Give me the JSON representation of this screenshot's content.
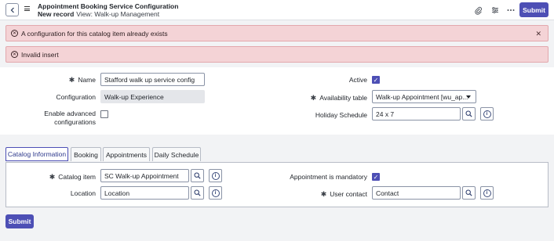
{
  "header": {
    "title": "Appointment Booking Service Configuration",
    "subtitle": "New record",
    "view_label": "View: Walk-up Management",
    "submit_label": "Submit"
  },
  "alerts": [
    {
      "text": "A configuration for this catalog item already exists",
      "closable": true
    },
    {
      "text": "Invalid insert",
      "closable": false
    }
  ],
  "form": {
    "name": {
      "label": "Name",
      "value": "Stafford walk up service config",
      "required": true
    },
    "configuration": {
      "label": "Configuration",
      "value": "Walk-up Experience"
    },
    "enable_advanced": {
      "label_line1": "Enable advanced",
      "label_line2": "configurations",
      "checked": false
    },
    "active": {
      "label": "Active",
      "checked": true
    },
    "availability_table": {
      "label": "Availability table",
      "value": "Walk-up Appointment [wu_ap...",
      "required": true
    },
    "holiday_schedule": {
      "label": "Holiday Schedule",
      "value": "24 x 7"
    }
  },
  "tabs": [
    {
      "label": "Catalog Information",
      "active": true
    },
    {
      "label": "Booking",
      "active": false
    },
    {
      "label": "Appointments",
      "active": false
    },
    {
      "label": "Daily Schedule",
      "active": false
    }
  ],
  "catalog": {
    "catalog_item": {
      "label": "Catalog item",
      "value": "SC Walk-up Appointment",
      "required": true
    },
    "location": {
      "label": "Location",
      "placeholder": "Location"
    },
    "appointment_mandatory": {
      "label": "Appointment is mandatory",
      "checked": true
    },
    "user_contact": {
      "label": "User contact",
      "placeholder": "Contact",
      "required": true
    }
  },
  "footer": {
    "submit_label": "Submit"
  },
  "icons": {
    "back": "chevron-left-icon",
    "menu": "hamburger-icon",
    "attach": "paperclip-icon",
    "settings": "sliders-icon",
    "more": "ellipsis-icon",
    "search": "search-icon",
    "info": "info-icon",
    "error": "error-circle-icon",
    "close": "close-icon"
  },
  "colors": {
    "primary": "#4d4fb5",
    "alert_bg": "#f4d3d6",
    "alert_border": "#e2a8ad"
  }
}
